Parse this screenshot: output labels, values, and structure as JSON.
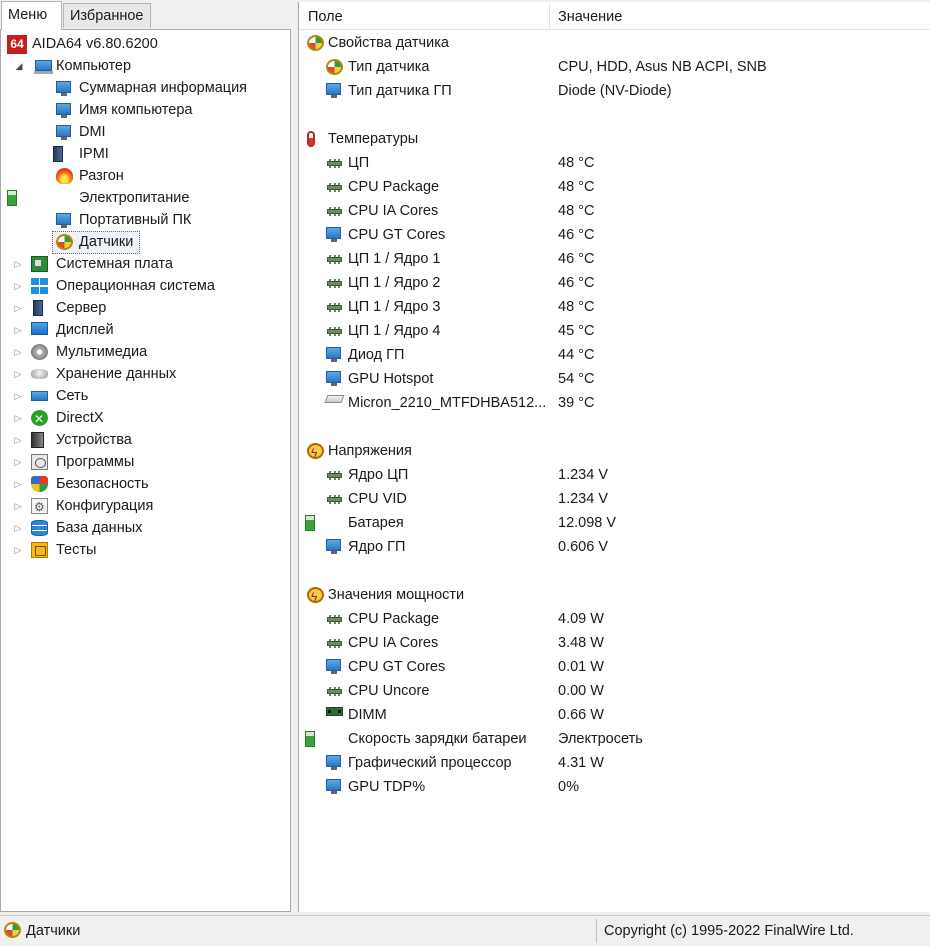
{
  "tabs": {
    "menu": "Меню",
    "favorites": "Избранное"
  },
  "tree": {
    "root": "AIDA64 v6.80.6200",
    "computer": "Компьютер",
    "computer_children": [
      {
        "label": "Суммарная информация",
        "icon": "monitor-icon"
      },
      {
        "label": "Имя компьютера",
        "icon": "monitor-icon"
      },
      {
        "label": "DMI",
        "icon": "monitor-icon"
      },
      {
        "label": "IPMI",
        "icon": "server-icon"
      },
      {
        "label": "Разгон",
        "icon": "flame-icon"
      },
      {
        "label": "Электропитание",
        "icon": "battery-icon"
      },
      {
        "label": "Портативный ПК",
        "icon": "laptop-icon"
      },
      {
        "label": "Датчики",
        "icon": "gauge-icon"
      }
    ],
    "categories": [
      {
        "label": "Системная плата",
        "icon": "motherboard-icon"
      },
      {
        "label": "Операционная система",
        "icon": "windows-icon"
      },
      {
        "label": "Сервер",
        "icon": "server-icon"
      },
      {
        "label": "Дисплей",
        "icon": "display-icon"
      },
      {
        "label": "Мультимедиа",
        "icon": "multimedia-icon"
      },
      {
        "label": "Хранение данных",
        "icon": "storage-icon"
      },
      {
        "label": "Сеть",
        "icon": "network-icon"
      },
      {
        "label": "DirectX",
        "icon": "xbox-icon"
      },
      {
        "label": "Устройства",
        "icon": "devices-icon"
      },
      {
        "label": "Программы",
        "icon": "programs-icon"
      },
      {
        "label": "Безопасность",
        "icon": "shield-icon"
      },
      {
        "label": "Конфигурация",
        "icon": "config-icon"
      },
      {
        "label": "База данных",
        "icon": "database-icon"
      },
      {
        "label": "Тесты",
        "icon": "tests-icon"
      }
    ],
    "selected": "Датчики"
  },
  "list": {
    "headers": {
      "field": "Поле",
      "value": "Значение"
    },
    "sensor_props": {
      "title": "Свойства датчика",
      "rows": [
        {
          "field": "Тип датчика",
          "value": "CPU, HDD, Asus NB ACPI, SNB",
          "icon": "gauge-icon"
        },
        {
          "field": "Тип датчика ГП",
          "value": "Diode  (NV-Diode)",
          "icon": "gpu-icon"
        }
      ]
    },
    "temperatures": {
      "title": "Температуры",
      "rows": [
        {
          "field": "ЦП",
          "value": "48 °C",
          "icon": "cpu-icon"
        },
        {
          "field": "CPU Package",
          "value": "48 °C",
          "icon": "cpu-icon"
        },
        {
          "field": "CPU IA Cores",
          "value": "48 °C",
          "icon": "cpu-icon"
        },
        {
          "field": "CPU GT Cores",
          "value": "46 °C",
          "icon": "gpu-icon"
        },
        {
          "field": "ЦП 1 / Ядро 1",
          "value": "46 °C",
          "icon": "cpu-icon"
        },
        {
          "field": "ЦП 1 / Ядро 2",
          "value": "46 °C",
          "icon": "cpu-icon"
        },
        {
          "field": "ЦП 1 / Ядро 3",
          "value": "48 °C",
          "icon": "cpu-icon"
        },
        {
          "field": "ЦП 1 / Ядро 4",
          "value": "45 °C",
          "icon": "cpu-icon"
        },
        {
          "field": "Диод ГП",
          "value": "44 °C",
          "icon": "gpu-icon"
        },
        {
          "field": "GPU Hotspot",
          "value": "54 °C",
          "icon": "gpu-icon"
        },
        {
          "field": "Micron_2210_MTFDHBA512...",
          "value": "39 °C",
          "icon": "ssd-icon"
        }
      ]
    },
    "voltages": {
      "title": "Напряжения",
      "rows": [
        {
          "field": "Ядро ЦП",
          "value": "1.234 V",
          "icon": "cpu-icon"
        },
        {
          "field": "CPU VID",
          "value": "1.234 V",
          "icon": "cpu-icon"
        },
        {
          "field": "Батарея",
          "value": "12.098 V",
          "icon": "battery-icon"
        },
        {
          "field": "Ядро ГП",
          "value": "0.606 V",
          "icon": "gpu-icon"
        }
      ]
    },
    "power": {
      "title": "Значения мощности",
      "rows": [
        {
          "field": "CPU Package",
          "value": "4.09 W",
          "icon": "cpu-icon"
        },
        {
          "field": "CPU IA Cores",
          "value": "3.48 W",
          "icon": "cpu-icon"
        },
        {
          "field": "CPU GT Cores",
          "value": "0.01 W",
          "icon": "gpu-icon"
        },
        {
          "field": "CPU Uncore",
          "value": "0.00 W",
          "icon": "cpu-icon"
        },
        {
          "field": "DIMM",
          "value": "0.66 W",
          "icon": "dimm-icon"
        },
        {
          "field": "Скорость зарядки батареи",
          "value": "Электросеть",
          "icon": "battery-icon"
        },
        {
          "field": "Графический процессор",
          "value": "4.31 W",
          "icon": "gpu-icon"
        },
        {
          "field": "GPU TDP%",
          "value": "0%",
          "icon": "gpu-icon"
        }
      ]
    }
  },
  "statusbar": {
    "left": "Датчики",
    "right": "Copyright (c) 1995-2022 FinalWire Ltd."
  }
}
